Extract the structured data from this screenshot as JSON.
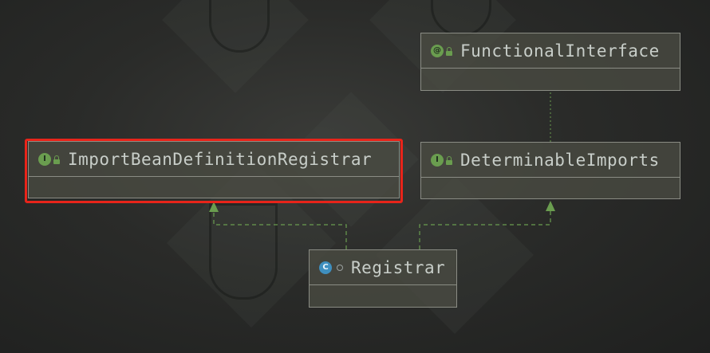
{
  "nodes": [
    {
      "key": "functional_interface",
      "name": "FunctionalInterface",
      "kind": "annotation",
      "badge": "@"
    },
    {
      "key": "import_bean",
      "name": "ImportBeanDefinitionRegistrar",
      "kind": "interface",
      "badge": "I"
    },
    {
      "key": "determinable",
      "name": "DeterminableImports",
      "kind": "interface",
      "badge": "I"
    },
    {
      "key": "registrar",
      "name": "Registrar",
      "kind": "class",
      "badge": "C"
    }
  ],
  "edges": [
    {
      "from": "registrar",
      "to": "import_bean",
      "style": "dashed",
      "arrow": "implements"
    },
    {
      "from": "registrar",
      "to": "determinable",
      "style": "dashed",
      "arrow": "implements"
    },
    {
      "from": "determinable",
      "to": "functional_interface",
      "style": "dotted",
      "arrow": "annotated-by"
    }
  ],
  "colors": {
    "edge": "#6a9d4f",
    "highlight": "#e8241a",
    "interface_badge": "#6a9d4f",
    "class_badge": "#3f8fbf",
    "text": "#c8cec9"
  },
  "highlighted_node": "import_bean"
}
